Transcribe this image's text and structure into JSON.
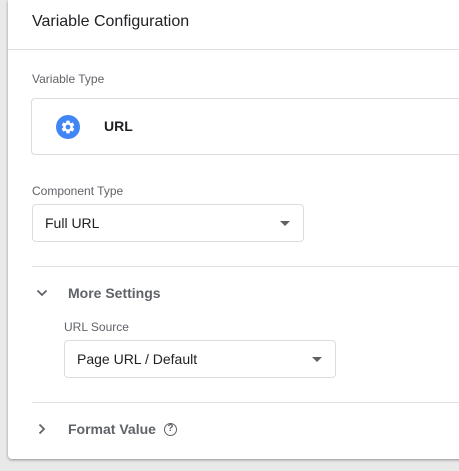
{
  "card": {
    "title": "Variable Configuration"
  },
  "variable_type": {
    "label": "Variable Type",
    "icon": "gear-icon",
    "icon_color": "#4285f4",
    "value": "URL"
  },
  "component_type": {
    "label": "Component Type",
    "selected": "Full URL"
  },
  "more_settings": {
    "label": "More Settings",
    "expanded": true,
    "url_source": {
      "label": "URL Source",
      "selected": "Page URL / Default"
    }
  },
  "format_value": {
    "label": "Format Value",
    "expanded": false,
    "help_icon": "help-circle-icon",
    "help_glyph": "?"
  }
}
